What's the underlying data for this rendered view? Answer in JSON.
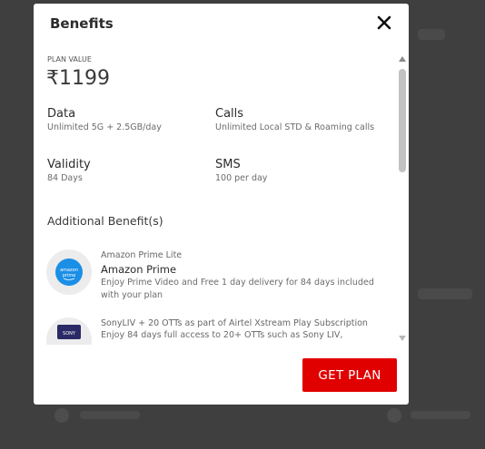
{
  "modal": {
    "title": "Benefits",
    "close_icon": "close-icon"
  },
  "plan": {
    "label": "PLAN VALUE",
    "value": "₹1199"
  },
  "features": [
    {
      "title": "Data",
      "desc": "Unlimited 5G + 2.5GB/day"
    },
    {
      "title": "Calls",
      "desc": "Unlimited Local STD & Roaming calls"
    },
    {
      "title": "Validity",
      "desc": "84 Days"
    },
    {
      "title": "SMS",
      "desc": "100 per day"
    }
  ],
  "additional": {
    "title": "Additional Benefit(s)",
    "items": [
      {
        "subtitle": "Amazon Prime Lite",
        "name": "Amazon Prime",
        "desc": "Enjoy Prime Video and Free 1 day delivery for 84 days included with your plan",
        "logo_text": "amazon prime",
        "icon": "amazon-prime-logo"
      },
      {
        "subtitle": "SonyLIV + 20 OTTs as part of Airtel Xstream Play Subscription",
        "name": "",
        "desc": "Enjoy 84 days full access to 20+ OTTs such as Sony LIV,",
        "logo_text": "SONY",
        "icon": "sonyliv-logo"
      }
    ]
  },
  "cta": {
    "get_plan_label": "GET PLAN"
  },
  "colors": {
    "accent": "#e10000",
    "overlay": "#3f3f3f",
    "prime_blue": "#1b8fe6"
  }
}
